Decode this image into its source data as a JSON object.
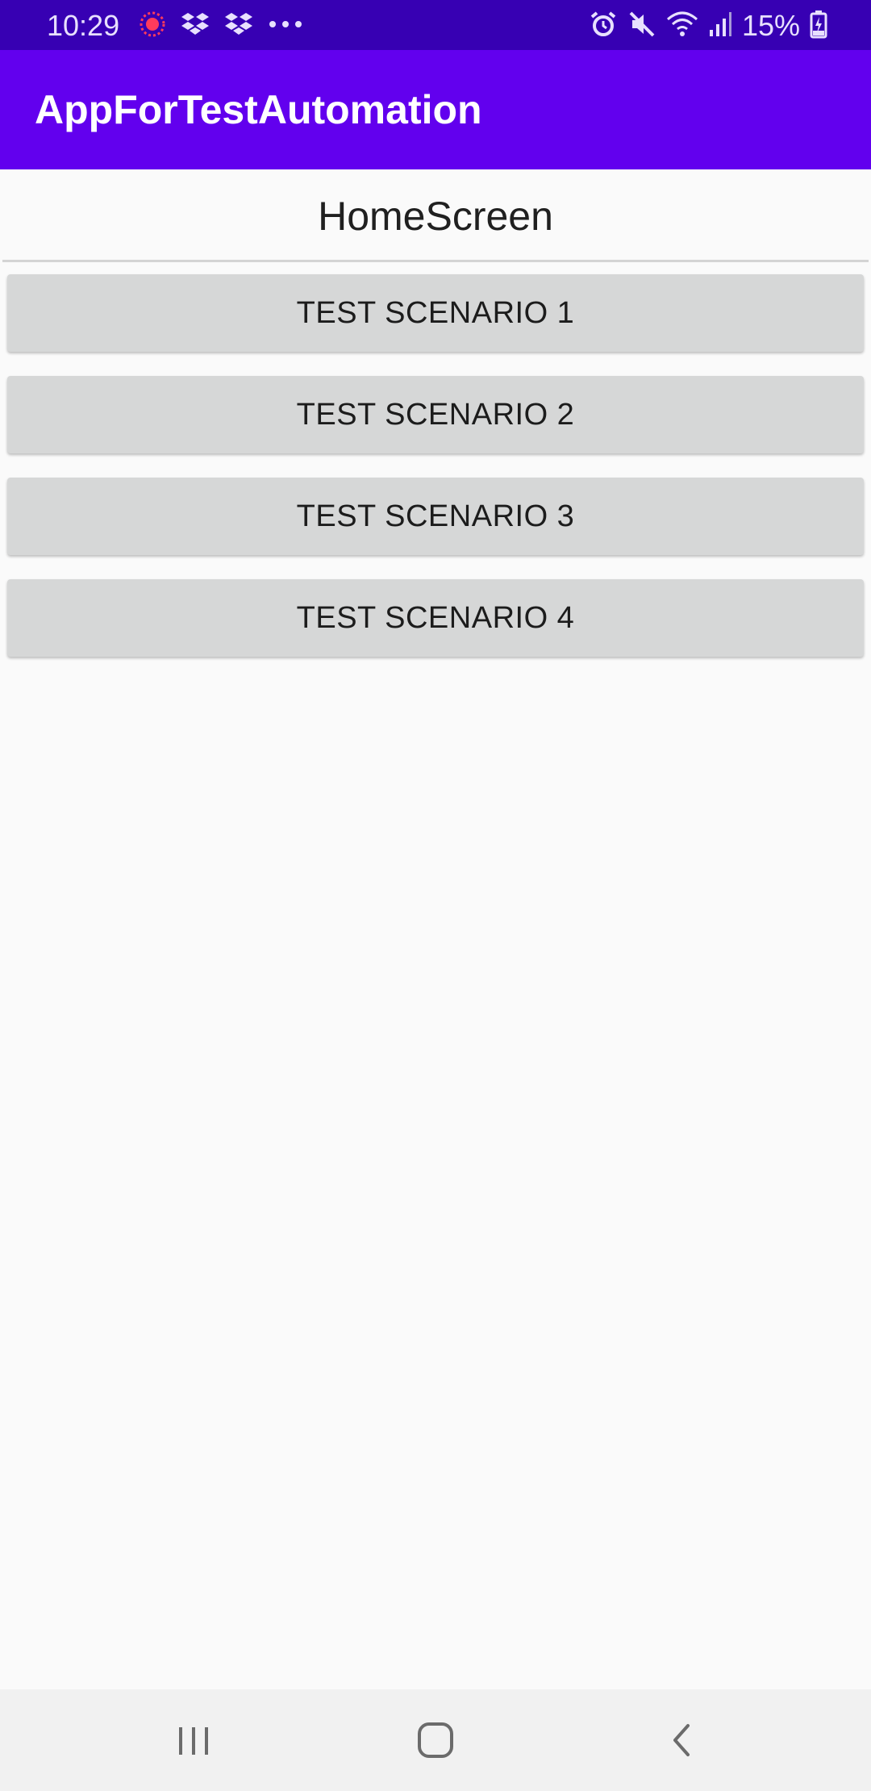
{
  "status_bar": {
    "time": "10:29",
    "battery": "15%",
    "left_icons": [
      "record-icon",
      "dropbox-icon",
      "dropbox-icon",
      "more-notifications-icon"
    ],
    "right_icons": [
      "alarm-icon",
      "mute-icon",
      "wifi-icon",
      "signal-icon",
      "battery-charging-icon"
    ]
  },
  "app_bar": {
    "title": "AppForTestAutomation",
    "color": "#6200ee"
  },
  "home": {
    "heading": "HomeScreen",
    "buttons": [
      {
        "label": "TEST SCENARIO 1"
      },
      {
        "label": "TEST SCENARIO 2"
      },
      {
        "label": "TEST SCENARIO 3"
      },
      {
        "label": "TEST SCENARIO 4"
      }
    ]
  },
  "nav_bar": {
    "icons": [
      "recent-apps-icon",
      "home-icon",
      "back-icon"
    ]
  },
  "colors": {
    "status_bar": "#3700b3",
    "app_bar": "#6200ee",
    "button_bg": "#d6d7d7",
    "background": "#fafafa"
  }
}
